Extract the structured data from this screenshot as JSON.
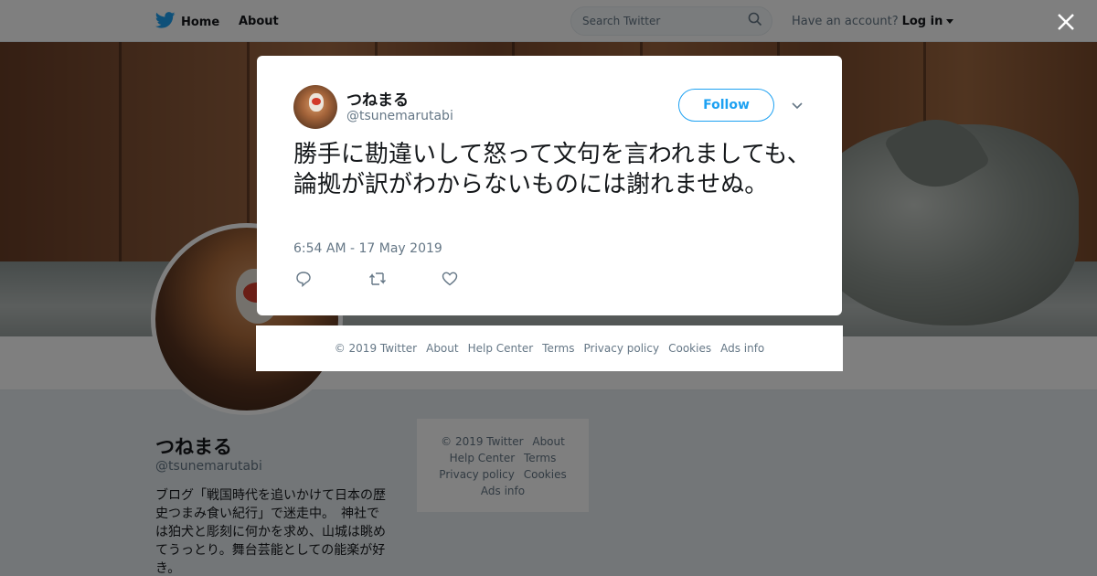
{
  "topbar": {
    "home_label": "Home",
    "about_label": "About",
    "search_placeholder": "Search Twitter",
    "account_prompt": "Have an account?",
    "login_label": "Log in"
  },
  "profile": {
    "name": "つねまる",
    "handle": "@tsunemarutabi",
    "bio": "ブログ「戦国時代を追いかけて日本の歴史つまみ食い紀行」で迷走中。　神社では狛犬と彫刻に何かを求め、山城は眺めてうっとり。舞台芸能としての能楽が好き。"
  },
  "side_footer": {
    "items": [
      "© 2019 Twitter",
      "About",
      "Help Center",
      "Terms",
      "Privacy policy",
      "Cookies",
      "Ads info"
    ]
  },
  "tweet": {
    "author_name": "つねまる",
    "author_handle": "@tsunemarutabi",
    "follow_label": "Follow",
    "text": "勝手に勘違いして怒って文句を言われましても、論拠が訳がわからないものには謝れませぬ。",
    "timestamp": "6:54 AM - 17 May 2019"
  },
  "modal_footer": {
    "items": [
      "© 2019 Twitter",
      "About",
      "Help Center",
      "Terms",
      "Privacy policy",
      "Cookies",
      "Ads info"
    ]
  },
  "colors": {
    "brand_blue": "#1da1f2",
    "secondary_text": "#657786",
    "primary_text": "#14171a",
    "page_bg": "#e6ecf0"
  },
  "icons": [
    "twitter-bird-icon",
    "home-icon",
    "search-icon",
    "caret-down-icon",
    "close-icon",
    "chevron-down-icon",
    "reply-icon",
    "retweet-icon",
    "like-icon"
  ]
}
